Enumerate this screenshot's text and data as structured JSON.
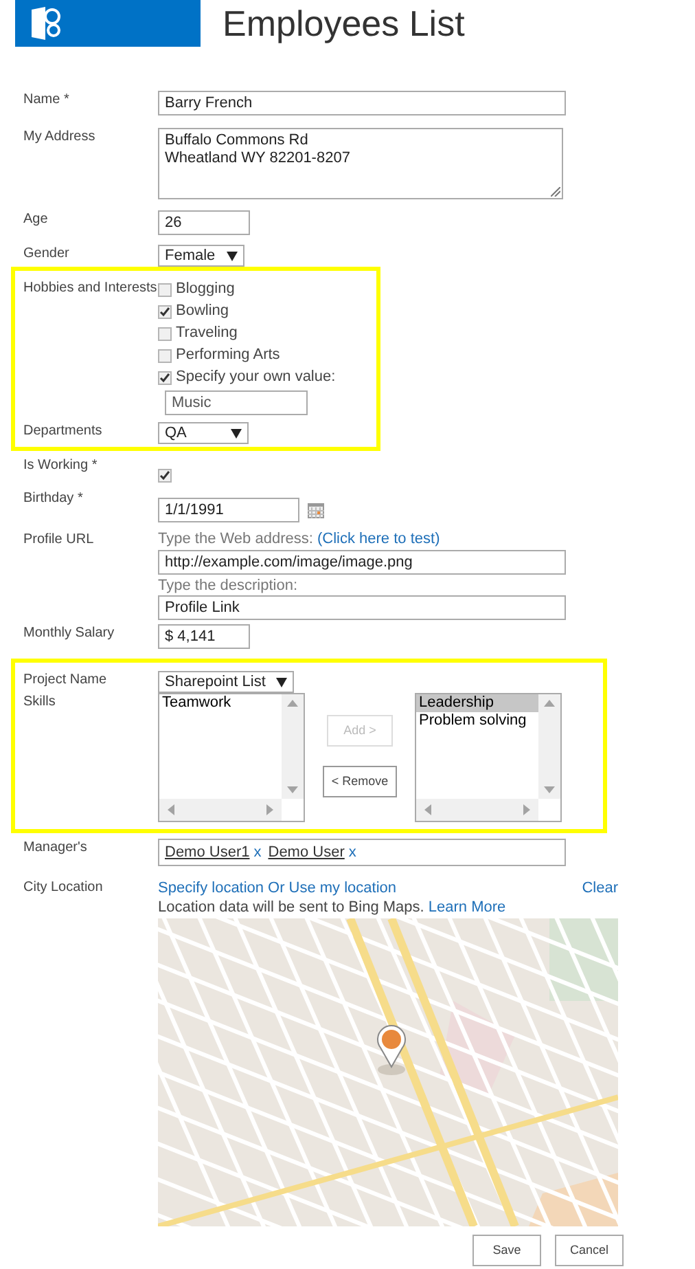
{
  "title": "Employees List",
  "groups": [
    {
      "highlighted": false,
      "fields": [
        {
          "kind": "text",
          "label": "Name *",
          "value": "Barry French"
        },
        {
          "kind": "textarea",
          "label": "My Address",
          "lines": [
            "Buffalo Commons Rd",
            "Wheatland WY 82201-8207"
          ]
        },
        {
          "kind": "number",
          "label": "Age",
          "value": "26"
        },
        {
          "kind": "select",
          "label": "Gender",
          "value": "Female"
        }
      ]
    },
    {
      "highlighted": true,
      "fields": [
        {
          "kind": "checkboxes",
          "label": "Hobbies and Interests",
          "options": [
            {
              "label": "Blogging",
              "checked": false
            },
            {
              "label": "Bowling",
              "checked": true
            },
            {
              "label": "Traveling",
              "checked": false
            },
            {
              "label": "Performing Arts",
              "checked": false
            },
            {
              "label": "Specify your own value:",
              "checked": true
            }
          ],
          "own_value": "Music"
        },
        {
          "kind": "select",
          "label": "Departments",
          "value": "QA"
        }
      ]
    },
    {
      "highlighted": false,
      "fields": [
        {
          "kind": "checkbox",
          "label": "Is Working *",
          "checked": true
        },
        {
          "kind": "date",
          "label": "Birthday *",
          "value": "1/1/1991"
        },
        {
          "kind": "url",
          "label": "Profile URL",
          "address_prompt": "Type the Web address:",
          "test_link": "(Click here to test)",
          "address": "http://example.com/image/image.png",
          "description_prompt": "Type the description:",
          "description": "Profile Link"
        },
        {
          "kind": "number",
          "label": "Monthly Salary",
          "value": "$ 4,141"
        }
      ]
    },
    {
      "highlighted": true,
      "fields": [
        {
          "kind": "select",
          "label": "Project Name",
          "value": "Sharepoint List"
        },
        {
          "kind": "skills",
          "label": "Skills",
          "available": [
            {
              "label": "Teamwork",
              "selected": false
            }
          ],
          "add_button": {
            "label": "Add >",
            "disabled": true
          },
          "remove_button": {
            "label": "< Remove",
            "disabled": false
          },
          "chosen": [
            {
              "label": "Leadership",
              "selected": true
            },
            {
              "label": "Problem solving",
              "selected": false
            }
          ]
        }
      ]
    },
    {
      "highlighted": false,
      "fields": [
        {
          "kind": "people",
          "label": "Manager's",
          "people": [
            {
              "name": "Demo User1",
              "remove": "x"
            },
            {
              "name": "Demo User",
              "remove": "x"
            }
          ]
        },
        {
          "kind": "location",
          "label": "City Location",
          "specify_link": "Specify location",
          "or_text": "Or",
          "use_link": "Use my location",
          "clear_link": "Clear",
          "notice": "Location data will be sent to Bing Maps.",
          "learn_more": "Learn More"
        }
      ]
    }
  ],
  "buttons": [
    {
      "label": "Save"
    },
    {
      "label": "Cancel"
    }
  ]
}
